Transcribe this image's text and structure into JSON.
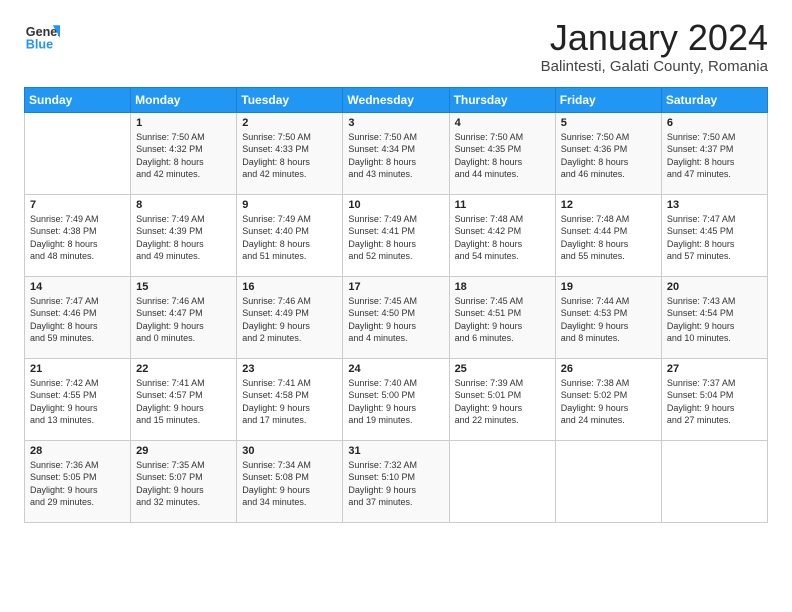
{
  "logo": {
    "line1": "General",
    "line2": "Blue"
  },
  "title": "January 2024",
  "subtitle": "Balintesti, Galati County, Romania",
  "headers": [
    "Sunday",
    "Monday",
    "Tuesday",
    "Wednesday",
    "Thursday",
    "Friday",
    "Saturday"
  ],
  "weeks": [
    [
      {
        "day": "",
        "content": ""
      },
      {
        "day": "1",
        "content": "Sunrise: 7:50 AM\nSunset: 4:32 PM\nDaylight: 8 hours\nand 42 minutes."
      },
      {
        "day": "2",
        "content": "Sunrise: 7:50 AM\nSunset: 4:33 PM\nDaylight: 8 hours\nand 42 minutes."
      },
      {
        "day": "3",
        "content": "Sunrise: 7:50 AM\nSunset: 4:34 PM\nDaylight: 8 hours\nand 43 minutes."
      },
      {
        "day": "4",
        "content": "Sunrise: 7:50 AM\nSunset: 4:35 PM\nDaylight: 8 hours\nand 44 minutes."
      },
      {
        "day": "5",
        "content": "Sunrise: 7:50 AM\nSunset: 4:36 PM\nDaylight: 8 hours\nand 46 minutes."
      },
      {
        "day": "6",
        "content": "Sunrise: 7:50 AM\nSunset: 4:37 PM\nDaylight: 8 hours\nand 47 minutes."
      }
    ],
    [
      {
        "day": "7",
        "content": "Sunrise: 7:49 AM\nSunset: 4:38 PM\nDaylight: 8 hours\nand 48 minutes."
      },
      {
        "day": "8",
        "content": "Sunrise: 7:49 AM\nSunset: 4:39 PM\nDaylight: 8 hours\nand 49 minutes."
      },
      {
        "day": "9",
        "content": "Sunrise: 7:49 AM\nSunset: 4:40 PM\nDaylight: 8 hours\nand 51 minutes."
      },
      {
        "day": "10",
        "content": "Sunrise: 7:49 AM\nSunset: 4:41 PM\nDaylight: 8 hours\nand 52 minutes."
      },
      {
        "day": "11",
        "content": "Sunrise: 7:48 AM\nSunset: 4:42 PM\nDaylight: 8 hours\nand 54 minutes."
      },
      {
        "day": "12",
        "content": "Sunrise: 7:48 AM\nSunset: 4:44 PM\nDaylight: 8 hours\nand 55 minutes."
      },
      {
        "day": "13",
        "content": "Sunrise: 7:47 AM\nSunset: 4:45 PM\nDaylight: 8 hours\nand 57 minutes."
      }
    ],
    [
      {
        "day": "14",
        "content": "Sunrise: 7:47 AM\nSunset: 4:46 PM\nDaylight: 8 hours\nand 59 minutes."
      },
      {
        "day": "15",
        "content": "Sunrise: 7:46 AM\nSunset: 4:47 PM\nDaylight: 9 hours\nand 0 minutes."
      },
      {
        "day": "16",
        "content": "Sunrise: 7:46 AM\nSunset: 4:49 PM\nDaylight: 9 hours\nand 2 minutes."
      },
      {
        "day": "17",
        "content": "Sunrise: 7:45 AM\nSunset: 4:50 PM\nDaylight: 9 hours\nand 4 minutes."
      },
      {
        "day": "18",
        "content": "Sunrise: 7:45 AM\nSunset: 4:51 PM\nDaylight: 9 hours\nand 6 minutes."
      },
      {
        "day": "19",
        "content": "Sunrise: 7:44 AM\nSunset: 4:53 PM\nDaylight: 9 hours\nand 8 minutes."
      },
      {
        "day": "20",
        "content": "Sunrise: 7:43 AM\nSunset: 4:54 PM\nDaylight: 9 hours\nand 10 minutes."
      }
    ],
    [
      {
        "day": "21",
        "content": "Sunrise: 7:42 AM\nSunset: 4:55 PM\nDaylight: 9 hours\nand 13 minutes."
      },
      {
        "day": "22",
        "content": "Sunrise: 7:41 AM\nSunset: 4:57 PM\nDaylight: 9 hours\nand 15 minutes."
      },
      {
        "day": "23",
        "content": "Sunrise: 7:41 AM\nSunset: 4:58 PM\nDaylight: 9 hours\nand 17 minutes."
      },
      {
        "day": "24",
        "content": "Sunrise: 7:40 AM\nSunset: 5:00 PM\nDaylight: 9 hours\nand 19 minutes."
      },
      {
        "day": "25",
        "content": "Sunrise: 7:39 AM\nSunset: 5:01 PM\nDaylight: 9 hours\nand 22 minutes."
      },
      {
        "day": "26",
        "content": "Sunrise: 7:38 AM\nSunset: 5:02 PM\nDaylight: 9 hours\nand 24 minutes."
      },
      {
        "day": "27",
        "content": "Sunrise: 7:37 AM\nSunset: 5:04 PM\nDaylight: 9 hours\nand 27 minutes."
      }
    ],
    [
      {
        "day": "28",
        "content": "Sunrise: 7:36 AM\nSunset: 5:05 PM\nDaylight: 9 hours\nand 29 minutes."
      },
      {
        "day": "29",
        "content": "Sunrise: 7:35 AM\nSunset: 5:07 PM\nDaylight: 9 hours\nand 32 minutes."
      },
      {
        "day": "30",
        "content": "Sunrise: 7:34 AM\nSunset: 5:08 PM\nDaylight: 9 hours\nand 34 minutes."
      },
      {
        "day": "31",
        "content": "Sunrise: 7:32 AM\nSunset: 5:10 PM\nDaylight: 9 hours\nand 37 minutes."
      },
      {
        "day": "",
        "content": ""
      },
      {
        "day": "",
        "content": ""
      },
      {
        "day": "",
        "content": ""
      }
    ]
  ]
}
